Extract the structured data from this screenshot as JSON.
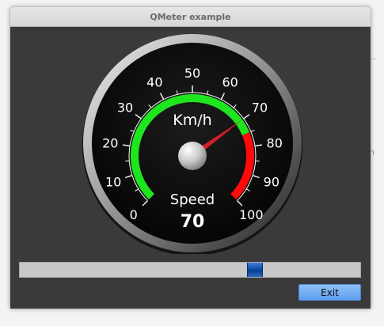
{
  "window": {
    "title": "QMeter example"
  },
  "meter": {
    "unit": "Km/h",
    "label": "Speed",
    "value": 70,
    "value_text": "70",
    "min": 0,
    "max": 100,
    "scale_labels": [
      "0",
      "10",
      "20",
      "30",
      "40",
      "50",
      "60",
      "70",
      "80",
      "90",
      "100"
    ],
    "green_range": [
      0,
      75
    ],
    "red_range": [
      75,
      100
    ],
    "colors": {
      "green": "#1ee61e",
      "red": "#ff0a0a",
      "needle": "#d21e28",
      "face": "#080808"
    }
  },
  "slider": {
    "value": 70,
    "min": 0,
    "max": 100
  },
  "exit_button": {
    "label": "Exit"
  }
}
